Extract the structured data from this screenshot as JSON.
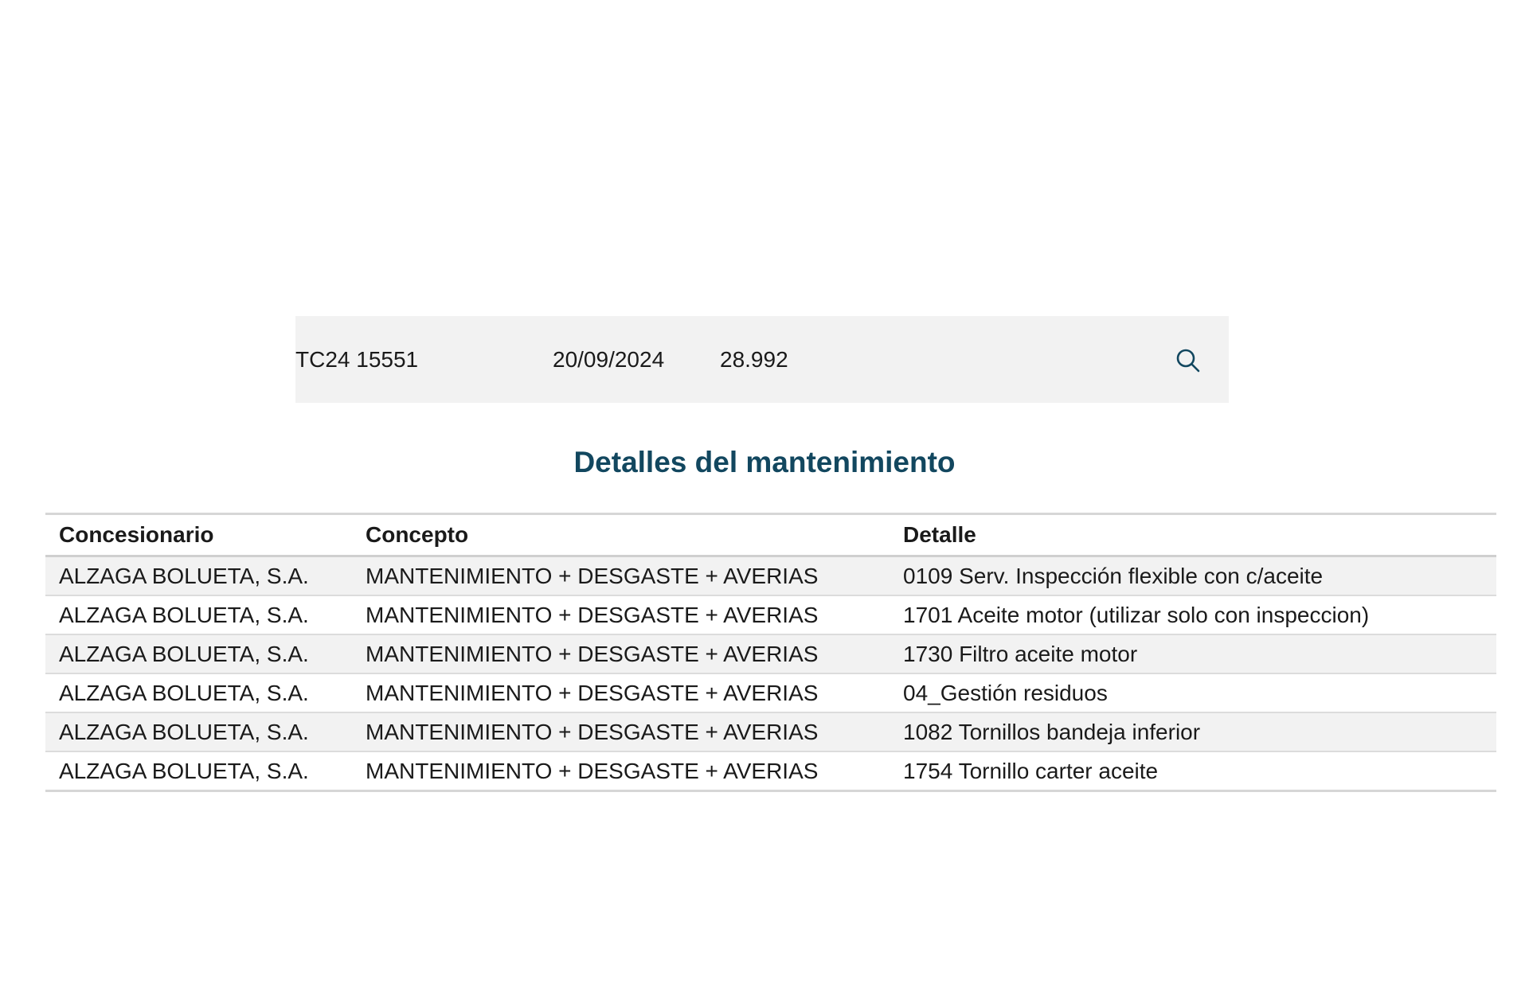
{
  "summary": {
    "reference": "TC24 15551",
    "date": "20/09/2024",
    "mileage": "28.992",
    "view_icon": "search-icon"
  },
  "section_title": "Detalles del mantenimiento",
  "table": {
    "headers": [
      "Concesionario",
      "Concepto",
      "Detalle"
    ],
    "rows": [
      [
        "ALZAGA BOLUETA, S.A.",
        "MANTENIMIENTO + DESGASTE + AVERIAS",
        "0109 Serv. Inspección flexible con c/aceite"
      ],
      [
        "ALZAGA BOLUETA, S.A.",
        "MANTENIMIENTO + DESGASTE + AVERIAS",
        "1701 Aceite motor (utilizar solo con inspeccion)"
      ],
      [
        "ALZAGA BOLUETA, S.A.",
        "MANTENIMIENTO + DESGASTE + AVERIAS",
        "1730 Filtro aceite motor"
      ],
      [
        "ALZAGA BOLUETA, S.A.",
        "MANTENIMIENTO + DESGASTE + AVERIAS",
        "04_Gestión residuos"
      ],
      [
        "ALZAGA BOLUETA, S.A.",
        "MANTENIMIENTO + DESGASTE + AVERIAS",
        "1082 Tornillos bandeja inferior"
      ],
      [
        "ALZAGA BOLUETA, S.A.",
        "MANTENIMIENTO + DESGASTE + AVERIAS",
        "1754 Tornillo carter aceite"
      ]
    ]
  },
  "colors": {
    "accent": "#12475f",
    "row_stripe": "#f2f2f2",
    "divider": "#d6d6d6"
  }
}
